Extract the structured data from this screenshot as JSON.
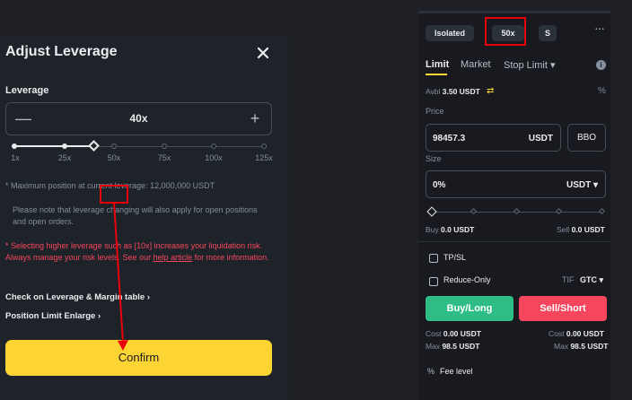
{
  "modal": {
    "title": "Adjust Leverage",
    "leverage_label": "Leverage",
    "leverage_value": "40x",
    "minus": "—",
    "plus": "+",
    "slider_ticks": [
      "1x",
      "25x",
      "50x",
      "75x",
      "100x",
      "125x"
    ],
    "slider_level_fraction": 0.32,
    "note_max_position_a": "* Maximum position at current leverage: ",
    "note_max_position_b": "12,000,000 USDT",
    "note_change": "Please note that leverage changing will also apply for open positions and open orders.",
    "warning_text": "* Selecting higher leverage such as [10x] increases your liquidation risk. Always manage your risk levels. See our ",
    "warning_link": "help article",
    "warning_tail": " for more information.",
    "link_check": "Check on Leverage & Margin table",
    "link_position": "Position Limit Enlarge",
    "confirm_label": "Confirm",
    "chevron": "›"
  },
  "panel": {
    "margin_mode": "Isolated",
    "leverage": "50x",
    "asset_mode": "S",
    "more": "···",
    "tabs": [
      "Limit",
      "Market",
      "Stop Limit"
    ],
    "tab_dropdown": "▾",
    "info": "i",
    "avbl_label": "Avbl",
    "avbl_value": "3.50 USDT",
    "swap_icon": "⇄",
    "calc_icon": "%",
    "price_label": "Price",
    "price_value": "98457.3",
    "price_unit": "USDT",
    "bbo": "BBO",
    "size_label": "Size",
    "size_value": "0%",
    "size_unit": "USDT ▾",
    "buy_label": "Buy",
    "buy_value": "0.0 USDT",
    "sell_label": "Sell",
    "sell_value": "0.0 USDT",
    "tpsl": "TP/SL",
    "reduce_only": "Reduce-Only",
    "tif_label": "TIF",
    "tif_value": "GTC ▾",
    "buy_button": "Buy/Long",
    "sell_button": "Sell/Short",
    "cost_label": "Cost",
    "cost_value": "0.00 USDT",
    "max_label": "Max",
    "max_value": "98.5 USDT",
    "fee_icon": "%",
    "fee_label": "Fee level"
  },
  "colors": {
    "accent_yellow": "#fcd535",
    "buy_green": "#2ebd85",
    "sell_red": "#f6465d",
    "highlight_red": "#e8000b"
  }
}
